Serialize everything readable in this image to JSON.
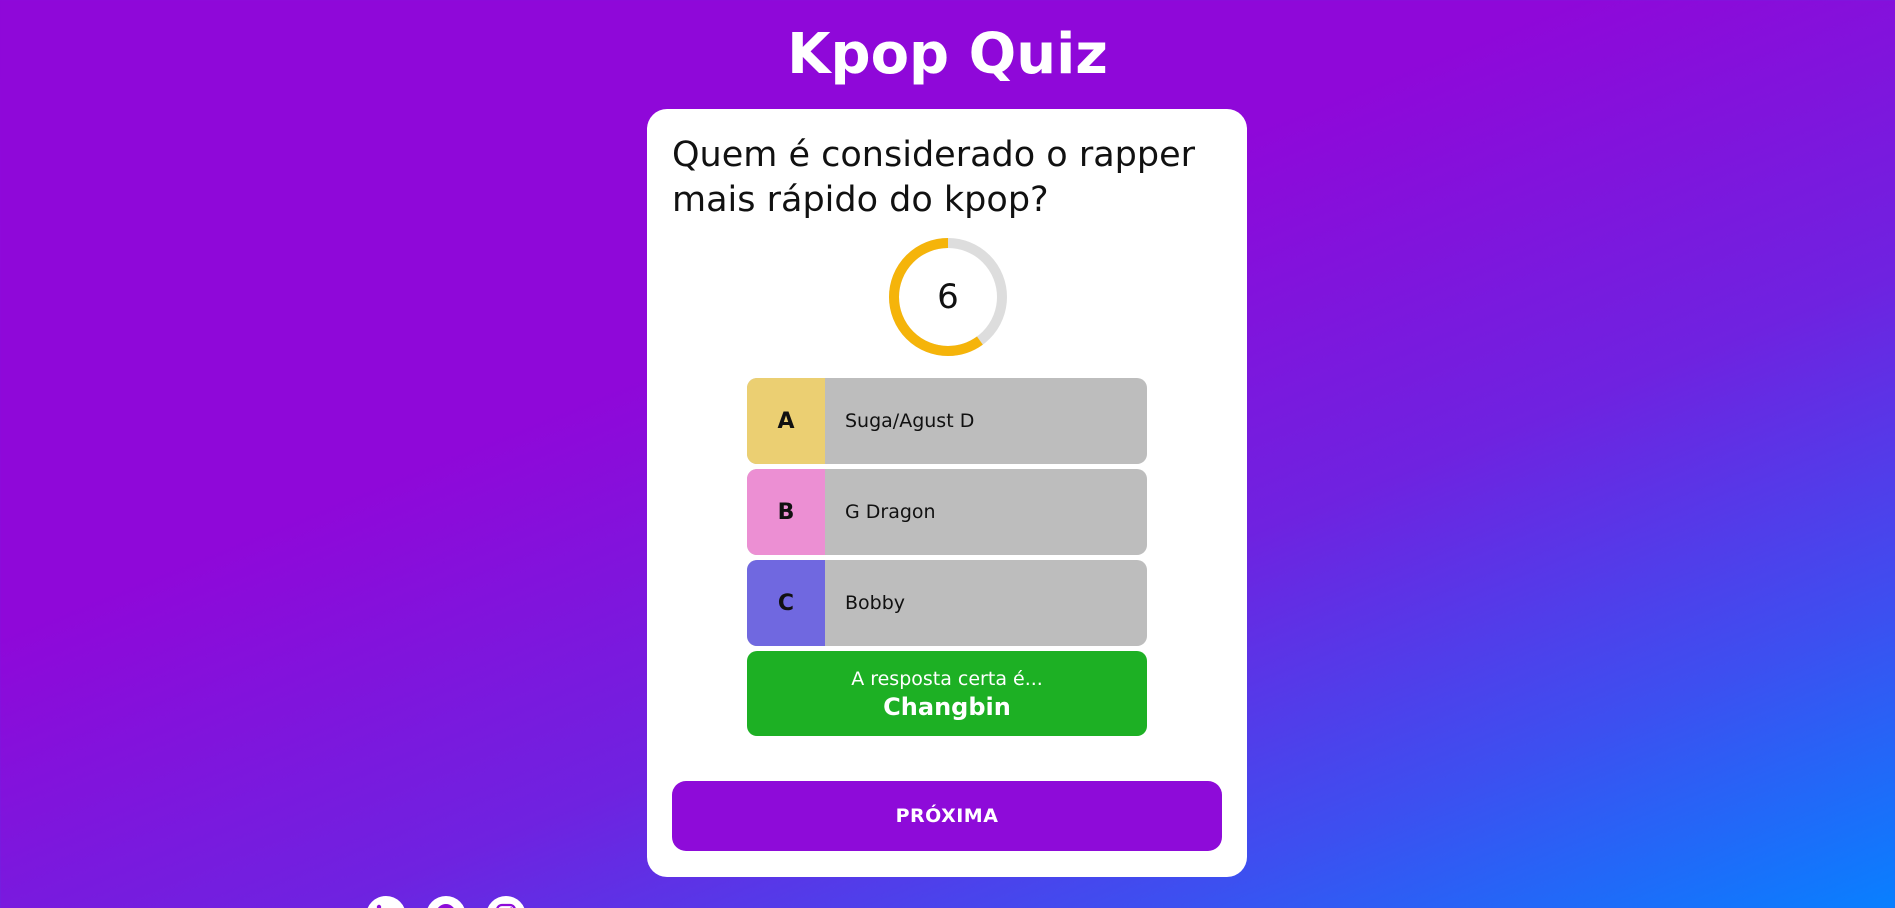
{
  "app": {
    "title": "Kpop Quiz"
  },
  "quiz": {
    "question": "Quem é considerado o rapper mais rápido do kpop?",
    "timer": {
      "value": "6",
      "progress_fraction": 0.6,
      "ring_color": "#f5b40a",
      "track_color": "#dddddd"
    },
    "answers": [
      {
        "letter": "A",
        "text": "Suga/Agust D",
        "color": "#ebcf72"
      },
      {
        "letter": "B",
        "text": "G Dragon",
        "color": "#ec8fd3"
      },
      {
        "letter": "C",
        "text": "Bobby",
        "color": "#7068e0"
      }
    ],
    "correct": {
      "lead": "A resposta certa é...",
      "answer": "Changbin",
      "color": "#1db024"
    },
    "next_label": "PRÓXIMA"
  },
  "footer": {
    "social_icons": [
      "linkedin-icon",
      "github-icon",
      "instagram-icon"
    ]
  },
  "colors": {
    "background_top": "#8f08d9",
    "background_bottom": "#0880ff",
    "accent": "#8e0bd9"
  }
}
